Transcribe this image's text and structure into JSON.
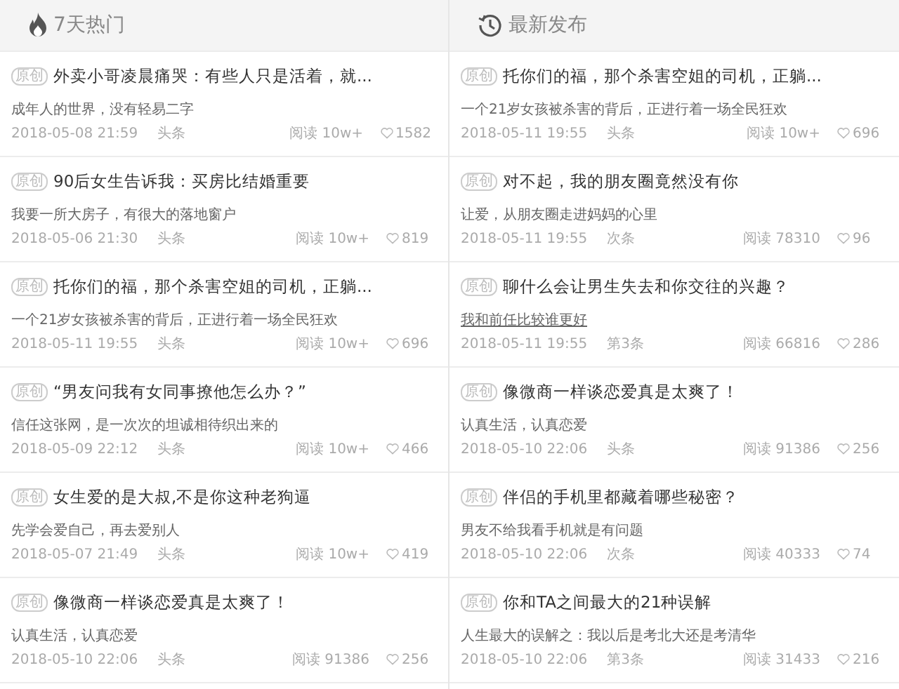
{
  "columns": [
    {
      "title": "7天热门",
      "articles": [
        {
          "badge": "原创",
          "title": "外卖小哥凌晨痛哭：有些人只是活着，就...",
          "subtitle": "成年人的世界，没有轻易二字",
          "underlined": false,
          "date": "2018-05-08 21:59",
          "position": "头条",
          "reads": "阅读 10w+",
          "likes": "1582"
        },
        {
          "badge": "原创",
          "title": "90后女生告诉我：买房比结婚重要",
          "subtitle": "我要一所大房子，有很大的落地窗户",
          "underlined": false,
          "date": "2018-05-06 21:30",
          "position": "头条",
          "reads": "阅读 10w+",
          "likes": "819"
        },
        {
          "badge": "原创",
          "title": "托你们的福，那个杀害空姐的司机，正躺...",
          "subtitle": "一个21岁女孩被杀害的背后，正进行着一场全民狂欢",
          "underlined": false,
          "date": "2018-05-11 19:55",
          "position": "头条",
          "reads": "阅读 10w+",
          "likes": "696"
        },
        {
          "badge": "原创",
          "title": "“男友问我有女同事撩他怎么办？”",
          "subtitle": "信任这张网，是一次次的坦诚相待织出来的",
          "underlined": false,
          "date": "2018-05-09 22:12",
          "position": "头条",
          "reads": "阅读 10w+",
          "likes": "466"
        },
        {
          "badge": "原创",
          "title": "女生爱的是大叔,不是你这种老狗逼",
          "subtitle": "先学会爱自己，再去爱别人",
          "underlined": false,
          "date": "2018-05-07 21:49",
          "position": "头条",
          "reads": "阅读 10w+",
          "likes": "419"
        },
        {
          "badge": "原创",
          "title": "像微商一样谈恋爱真是太爽了！",
          "subtitle": "认真生活，认真恋爱",
          "underlined": false,
          "date": "2018-05-10 22:06",
          "position": "头条",
          "reads": "阅读 91386",
          "likes": "256"
        }
      ]
    },
    {
      "title": "最新发布",
      "articles": [
        {
          "badge": "原创",
          "title": "托你们的福，那个杀害空姐的司机，正躺...",
          "subtitle": "一个21岁女孩被杀害的背后，正进行着一场全民狂欢",
          "underlined": false,
          "date": "2018-05-11 19:55",
          "position": "头条",
          "reads": "阅读 10w+",
          "likes": "696"
        },
        {
          "badge": "原创",
          "title": "对不起，我的朋友圈竟然没有你",
          "subtitle": "让爱，从朋友圈走进妈妈的心里",
          "underlined": false,
          "date": "2018-05-11 19:55",
          "position": "次条",
          "reads": "阅读 78310",
          "likes": "96"
        },
        {
          "badge": "原创",
          "title": "聊什么会让男生失去和你交往的兴趣？",
          "subtitle": "我和前任比较谁更好",
          "underlined": true,
          "date": "2018-05-11 19:55",
          "position": "第3条",
          "reads": "阅读 66816",
          "likes": "286"
        },
        {
          "badge": "原创",
          "title": "像微商一样谈恋爱真是太爽了！",
          "subtitle": "认真生活，认真恋爱",
          "underlined": false,
          "date": "2018-05-10 22:06",
          "position": "头条",
          "reads": "阅读 91386",
          "likes": "256"
        },
        {
          "badge": "原创",
          "title": "伴侣的手机里都藏着哪些秘密？",
          "subtitle": "男友不给我看手机就是有问题",
          "underlined": false,
          "date": "2018-05-10 22:06",
          "position": "次条",
          "reads": "阅读 40333",
          "likes": "74"
        },
        {
          "badge": "原创",
          "title": "你和TA之间最大的21种误解",
          "subtitle": "人生最大的误解之：我以后是考北大还是考清华",
          "underlined": false,
          "date": "2018-05-10 22:06",
          "position": "第3条",
          "reads": "阅读 31433",
          "likes": "216"
        }
      ]
    }
  ]
}
